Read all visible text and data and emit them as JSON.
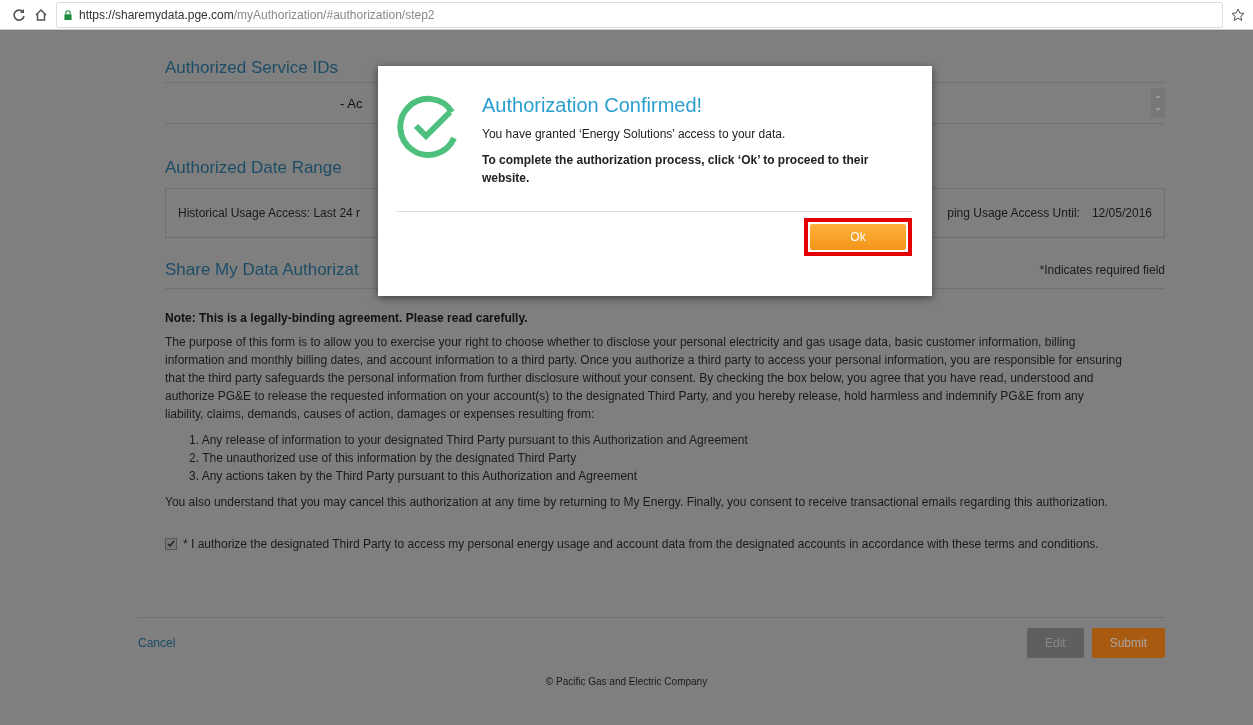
{
  "browser": {
    "url_host": "https://sharemydata.pge.com",
    "url_path": "/myAuthorization/#authorization/step2"
  },
  "service_ids": {
    "title": "Authorized Service IDs",
    "item": "- Ac"
  },
  "date_range": {
    "title": "Authorized Date Range",
    "historical": "Historical Usage Access: Last 24 r",
    "ongoing_label": "ping Usage Access Until:",
    "ongoing_date": "12/05/2016"
  },
  "agreement": {
    "title": "Share My Data Authorizat",
    "required_note": "*Indicates required field",
    "note": "Note: This is a legally-binding agreement. Please read carefully.",
    "paragraph": "The purpose of this form is to allow you to exercise your right to choose whether to disclose your personal electricity and gas usage data, basic customer information, billing information and monthly billing dates, and account information to a third party. Once you authorize a third party to access your personal information, you are responsible for ensuring that the third party safeguards the personal information from further disclosure without your consent. By checking the box below, you agree that you have read, understood and authorize PG&E to release the requested information on your account(s) to the designated Third Party, and you hereby release, hold harmless and indemnify PG&E from any liability, claims, demands, causes of action, damages or expenses resulting from:",
    "items": [
      {
        "number": "1.",
        "text": "Any release of information to your designated Third Party pursuant to this Authorization and Agreement"
      },
      {
        "number": "2.",
        "text": "The unauthorized use of this information by the designated Third Party"
      },
      {
        "number": "3.",
        "text": "Any actions taken by the Third Party pursuant to this Authorization and Agreement"
      }
    ],
    "closing": "You also understand that you may cancel this authorization at any time by returning to My Energy. Finally, you consent to receive transactional emails regarding this authorization.",
    "consent": {
      "checked": true,
      "label": "* I authorize the designated Third Party to access my personal energy usage and account data from the designated accounts in accordance with these terms and conditions."
    }
  },
  "footer": {
    "cancel": "Cancel",
    "buttons": [
      {
        "label": "Edit",
        "disabled": true
      },
      {
        "label": "Submit",
        "disabled": false
      }
    ],
    "copyright": "© Pacific Gas and Electric Company"
  },
  "dialog": {
    "title": "Authorization Confirmed!",
    "message": "You have granted ‘Energy Solutions’ access to your data.",
    "instruction": "To complete the authorization process, click ‘Ok’ to proceed to their website.",
    "ok": "Ok",
    "ok_highlighted": true
  }
}
